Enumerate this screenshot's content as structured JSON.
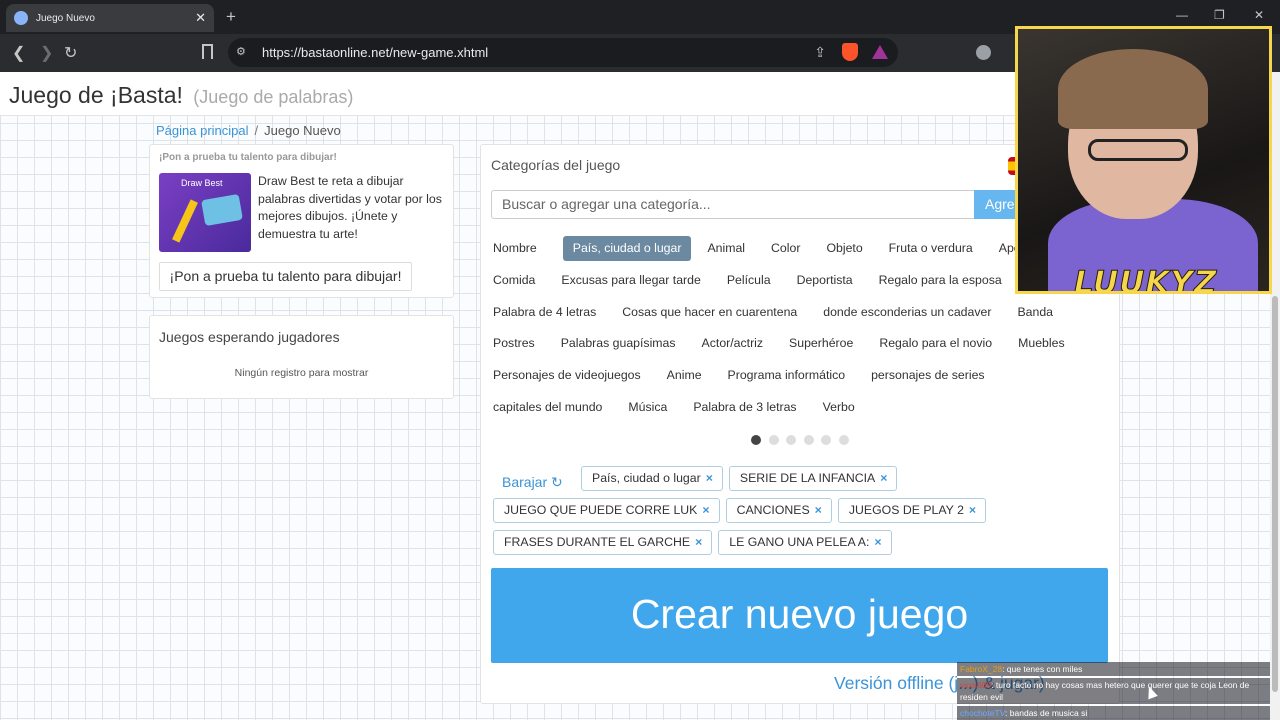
{
  "browser": {
    "tab_title": "Juego Nuevo",
    "url": "https://bastaonline.net/new-game.xhtml"
  },
  "header": {
    "title": "Juego de ¡Basta!",
    "subtitle": "(Juego de palabras)"
  },
  "breadcrumb": {
    "home": "Página principal",
    "separator": "/",
    "current": "Juego Nuevo"
  },
  "promo": {
    "heading": "¡Pon a prueba tu talento para dibujar!",
    "image_label": "Draw Best",
    "text": "Draw Best te reta a dibujar palabras divertidas y votar por los mejores dibujos. ¡Únete y demuestra tu arte!",
    "button": "¡Pon a prueba tu talento para dibujar!"
  },
  "waiting": {
    "title": "Juegos esperando jugadores",
    "empty": "Ningún registro para mostrar"
  },
  "categories": {
    "title": "Categorías del juego",
    "search_placeholder": "Buscar o agregar una categoría...",
    "add_button": "Agre",
    "rows": [
      [
        "Nombre",
        "País, ciudad o lugar",
        "Animal",
        "Color",
        "Objeto",
        "Fruta o verdura",
        "Ape"
      ],
      [
        "Comida",
        "Excusas para llegar tarde",
        "Película",
        "Deportista",
        "Regalo para la esposa"
      ],
      [
        "Palabra de 4 letras",
        "Cosas que hacer en cuarentena",
        "donde esconderias un cadaver",
        "Banda"
      ],
      [
        "Postres",
        "Palabras guapísimas",
        "Actor/actriz",
        "Superhéroe",
        "Regalo para el novio",
        "Muebles"
      ],
      [
        "Personajes de videojuegos",
        "Anime",
        "Programa informático",
        "personajes de series"
      ],
      [
        "capitales del mundo",
        "Música",
        "Palabra de 3 letras",
        "Verbo"
      ]
    ],
    "active": "País, ciudad o lugar",
    "pages": 6,
    "current_page": 1
  },
  "selected": {
    "shuffle_label": "Barajar",
    "rows": [
      [
        "País, ciudad o lugar",
        "SERIE DE LA INFANCIA"
      ],
      [
        "JUEGO QUE PUEDE CORRE LUK",
        "CANCIONES",
        "JUEGOS DE PLAY 2"
      ],
      [
        "FRASES DURANTE EL GARCHE",
        "LE GANO UNA PELEA A:"
      ]
    ],
    "remove_glyph": "×"
  },
  "create_button": "Crear nuevo juego",
  "offline_link": "Versión offline (j...) & jugar)",
  "stream": {
    "streamer_name": "LUUKYZ",
    "chat": [
      {
        "user": "FabroX_28",
        "msg": "que tenes con miles"
      },
      {
        "user": "vxxs609",
        "msg": "turo facto no hay cosas mas hetero que querer que te coja Leon de residen evil"
      },
      {
        "user": "chochoteTV",
        "msg": "bandas de musica si"
      }
    ]
  }
}
